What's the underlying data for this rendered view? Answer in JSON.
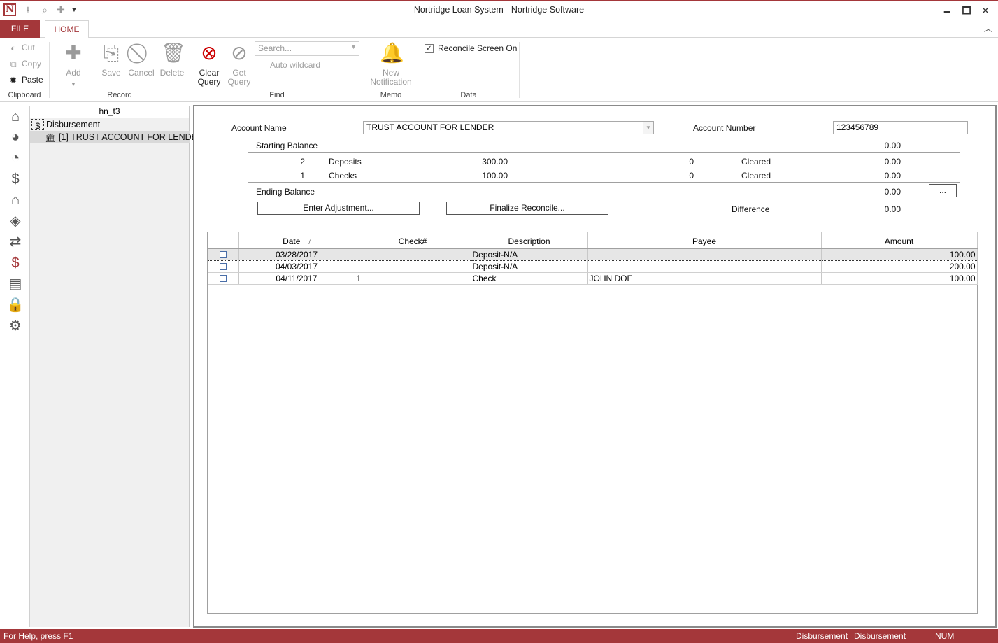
{
  "window": {
    "title": "Nortridge Loan System - Nortridge Software",
    "minimize": "🗕",
    "maximize": "🗖",
    "close": "✕"
  },
  "ribbon": {
    "tabs": {
      "file": "FILE",
      "home": "HOME"
    },
    "clipboard": {
      "cut": "Cut",
      "copy": "Copy",
      "paste": "Paste",
      "label": "Clipboard"
    },
    "record": {
      "add": "Add",
      "save": "Save",
      "cancel": "Cancel",
      "delete": "Delete",
      "label": "Record"
    },
    "find": {
      "clear_query_1": "Clear",
      "clear_query_2": "Query",
      "get_query_1": "Get",
      "get_query_2": "Query",
      "search_placeholder": "Search...",
      "auto_wildcard": "Auto wildcard",
      "label": "Find"
    },
    "memo": {
      "new_notification_1": "New",
      "new_notification_2": "Notification",
      "label": "Memo"
    },
    "data": {
      "reconcile_screen_on": "Reconcile Screen On",
      "reconcile_checked": true,
      "label": "Data"
    }
  },
  "tree": {
    "header": "hn_t3",
    "root": "Disbursement",
    "child": "[1] TRUST ACCOUNT FOR LENDER"
  },
  "form": {
    "account_name_label": "Account Name",
    "account_name_value": "TRUST ACCOUNT FOR LENDER",
    "account_number_label": "Account Number",
    "account_number_value": "123456789",
    "starting_balance_label": "Starting Balance",
    "starting_balance_value": "0.00",
    "deposits": {
      "count": "2",
      "label": "Deposits",
      "amount": "300.00",
      "cleared_count": "0",
      "cleared_label": "Cleared",
      "cleared_amount": "0.00"
    },
    "checks": {
      "count": "1",
      "label": "Checks",
      "amount": "100.00",
      "cleared_count": "0",
      "cleared_label": "Cleared",
      "cleared_amount": "0.00"
    },
    "ending_balance_label": "Ending Balance",
    "ending_balance_value": "0.00",
    "ellipsis_button": "...",
    "enter_adjustment_button": "Enter Adjustment...",
    "finalize_reconcile_button": "Finalize Reconcile...",
    "difference_label": "Difference",
    "difference_value": "0.00"
  },
  "grid": {
    "columns": {
      "date": "Date",
      "check": "Check#",
      "description": "Description",
      "payee": "Payee",
      "amount": "Amount",
      "sort_indicator": "/"
    },
    "rows": [
      {
        "date": "03/28/2017",
        "check": "",
        "description": "Deposit-N/A",
        "payee": "",
        "amount": "100.00"
      },
      {
        "date": "04/03/2017",
        "check": "",
        "description": "Deposit-N/A",
        "payee": "",
        "amount": "200.00"
      },
      {
        "date": "04/11/2017",
        "check": "1",
        "description": "Check",
        "payee": "JOHN DOE",
        "amount": "100.00"
      }
    ]
  },
  "statusbar": {
    "help": "For Help, press F1",
    "panel1": "Disbursement",
    "panel2": "Disbursement",
    "num": "NUM"
  },
  "colors": {
    "accent": "#a4373a"
  }
}
